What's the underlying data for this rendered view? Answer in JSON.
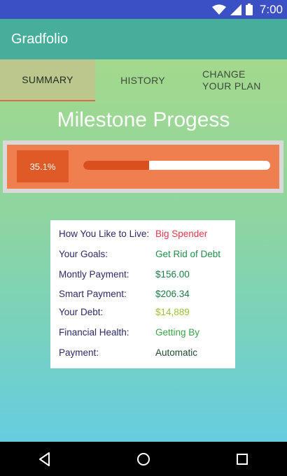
{
  "status_bar": {
    "time": "7:00"
  },
  "app_bar": {
    "title": "Gradfolio"
  },
  "tabs": [
    {
      "label": "SUMMARY",
      "selected": true
    },
    {
      "label": "HISTORY",
      "selected": false
    },
    {
      "label": "CHANGE YOUR PLAN",
      "selected": false
    }
  ],
  "page_title": "Milestone Progess",
  "progress": {
    "label": "35.1%",
    "fraction": 0.351
  },
  "info": [
    {
      "label": "How You Like to Live:",
      "value": "Big Spender",
      "value_color": "#e8374b"
    },
    {
      "label": "Your Goals:",
      "value": "Get Rid of Debt",
      "value_color": "#1f8f4a"
    },
    {
      "label": "Montly Payment:",
      "value": "$156.00",
      "value_color": "#1f7a45"
    },
    {
      "label": "Smart Payment:",
      "value": "$206.34",
      "value_color": "#1f7a45"
    },
    {
      "label": "Your Debt:",
      "value": "$14,889",
      "value_color": "#9cc23a"
    },
    {
      "label": "Financial Health:",
      "value": "Getting By",
      "value_color": "#3aa34a"
    },
    {
      "label": "Payment:",
      "value": "Automatic",
      "value_color": "#1f4a30"
    }
  ],
  "colors": {
    "status_bar": "#3a50c4",
    "app_bar": "#46ae9b",
    "progress_background": "#f07f4f",
    "progress_fill": "#d94f1e",
    "tab_indicator": "#e0674a"
  },
  "icons": {
    "status": [
      "wifi-icon",
      "signal-icon",
      "battery-icon"
    ],
    "nav": [
      "back-icon",
      "home-icon",
      "recents-icon"
    ]
  }
}
